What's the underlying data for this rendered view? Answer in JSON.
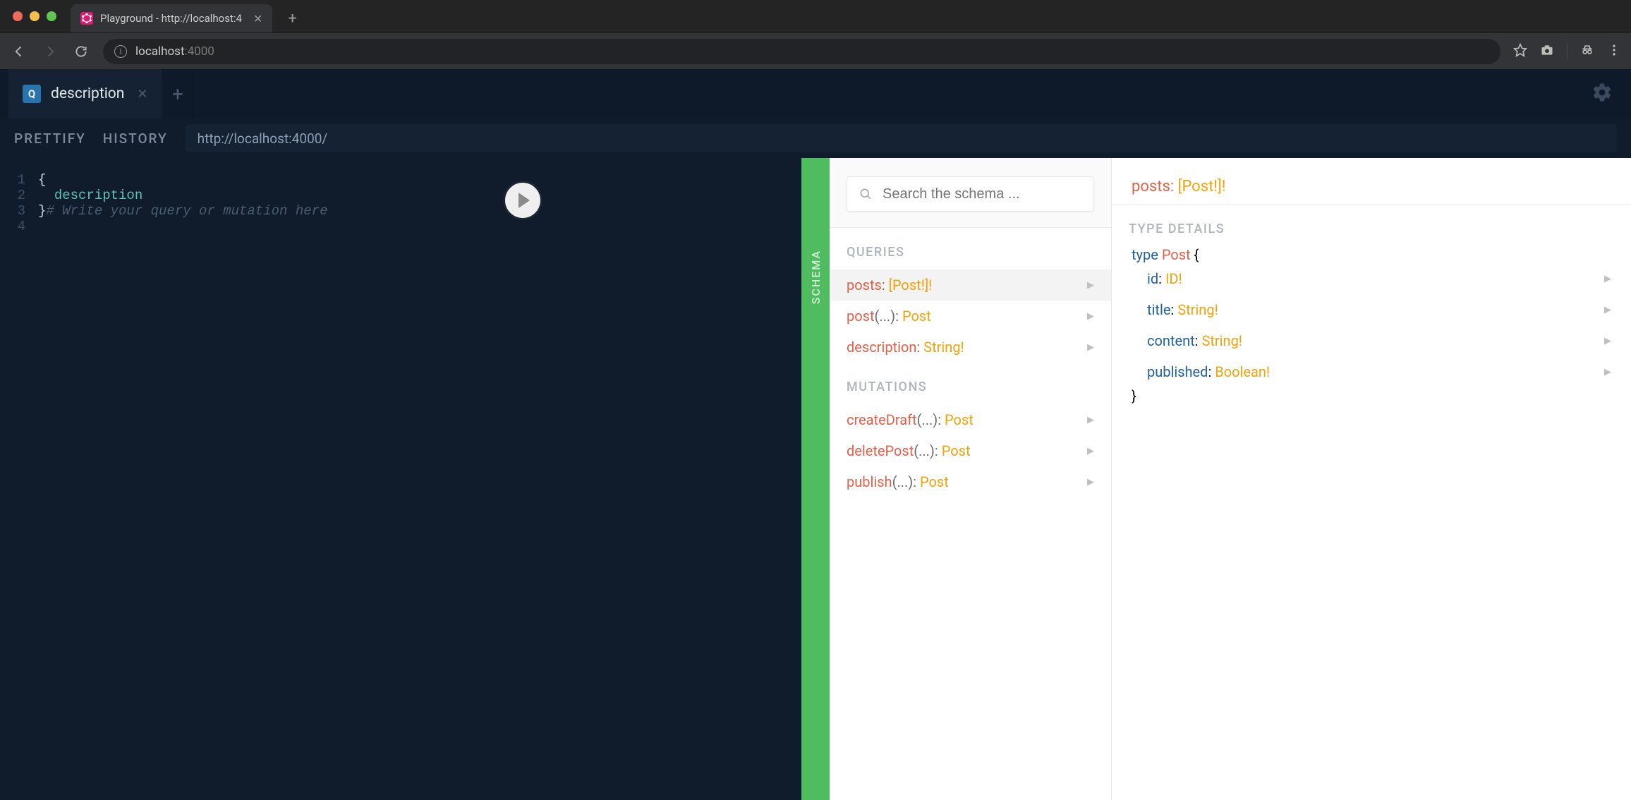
{
  "browser": {
    "tab_title": "Playground - http://localhost:4",
    "url_host": "localhost",
    "url_port": ":4000"
  },
  "playground": {
    "tab": {
      "badge": "Q",
      "label": "description"
    },
    "toolbar": {
      "prettify": "PRETTIFY",
      "history": "HISTORY",
      "endpoint": "http://localhost:4000/"
    },
    "editor": {
      "lines": [
        "1",
        "2",
        "3",
        "4"
      ],
      "l1": "{",
      "l2_field": "description",
      "l3_brace": "}",
      "l3_comment": "# Write your query or mutation here"
    },
    "schema_handle": "SCHEMA",
    "docs": {
      "search_placeholder": "Search the schema ...",
      "queries_title": "QUERIES",
      "mutations_title": "MUTATIONS",
      "type_details_title": "TYPE DETAILS",
      "queries": [
        {
          "name": "posts",
          "args": "",
          "sep": ": ",
          "type": "[Post!]!",
          "selected": true
        },
        {
          "name": "post",
          "args": "(...)",
          "sep": ": ",
          "type": "Post"
        },
        {
          "name": "description",
          "args": "",
          "sep": ": ",
          "type": "String!"
        }
      ],
      "mutations": [
        {
          "name": "createDraft",
          "args": "(...)",
          "sep": ": ",
          "type": "Post"
        },
        {
          "name": "deletePost",
          "args": "(...)",
          "sep": ": ",
          "type": "Post"
        },
        {
          "name": "publish",
          "args": "(...)",
          "sep": ": ",
          "type": "Post"
        }
      ],
      "detail_header": {
        "name": "posts",
        "sep": ": ",
        "type": "[Post!]!"
      },
      "type_def": {
        "kw_type": "type",
        "type_name": "Post",
        "open": " {",
        "close": "}",
        "fields": [
          {
            "name": "id",
            "sep": ": ",
            "type": "ID!"
          },
          {
            "name": "title",
            "sep": ": ",
            "type": "String!"
          },
          {
            "name": "content",
            "sep": ": ",
            "type": "String!"
          },
          {
            "name": "published",
            "sep": ": ",
            "type": "Boolean!"
          }
        ]
      }
    }
  }
}
